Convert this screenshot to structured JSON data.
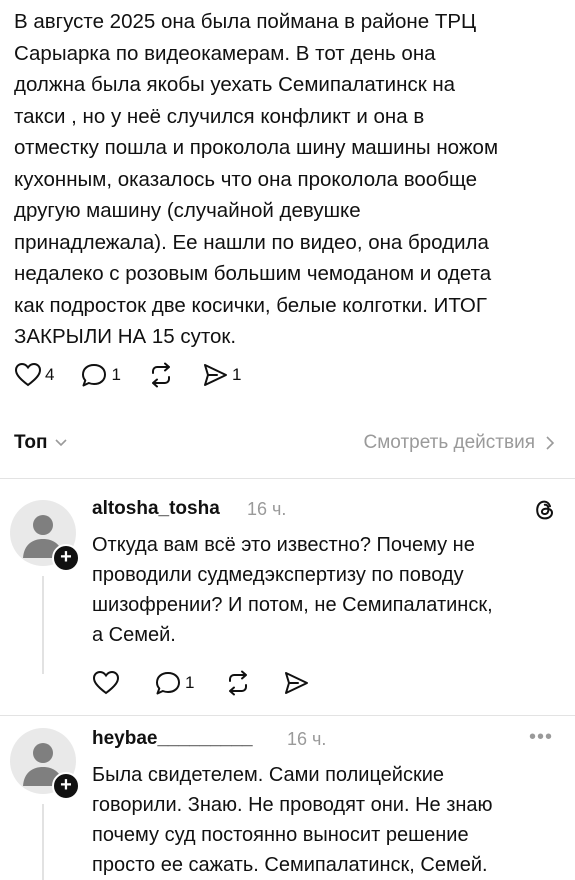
{
  "post": {
    "text_lines": [
      "В августе 2025 она была поймана  в районе ТРЦ",
      "Сарыарка по видеокамерам.  В тот день она",
      "должна была якобы уехать Семипалатинск на",
      "такси , но у неё случился конфликт и она в",
      "отместку пошла и проколола шину машины ножом",
      "кухонным, оказалось что она проколола вообще",
      "другую  машину (случайной девушке",
      "принадлежала). Ее нашли по видео, она бродила",
      "недалеко с розовым большим чемоданом и одета",
      "как подросток две косички, белые колготки. ИТОГ",
      "ЗАКРЫЛИ НА 15 суток."
    ],
    "likes": "4",
    "comments": "1",
    "shares": "1"
  },
  "sort_bar": {
    "sort_label": "Топ",
    "view_activity_label": "Смотреть действия"
  },
  "comments": [
    {
      "username": "altosha_tosha",
      "time": "16 ч.",
      "text_lines": [
        "Откуда вам всё это известно? Почему не",
        "проводили судмедэкспертизу по поводу",
        "шизофрении? И потом, не Семипалатинск,",
        "а Семей."
      ],
      "replies": "1",
      "badge_icon": "threads-logo-icon"
    },
    {
      "username": "heybae_________",
      "time": "16 ч.",
      "more": "•••",
      "text_lines": [
        "Была свидетелем. Сами полицейские",
        "говорили. Знаю. Не проводят они. Не знаю",
        "почему суд постоянно выносит решение",
        "просто ее сажать. Семипалатинск, Семей."
      ]
    }
  ],
  "icons": {
    "like": "heart-icon",
    "comment": "comment-bubble-icon",
    "repost": "repost-icon",
    "share": "send-icon",
    "avatar": "default-avatar-icon",
    "follow": "plus-icon"
  }
}
